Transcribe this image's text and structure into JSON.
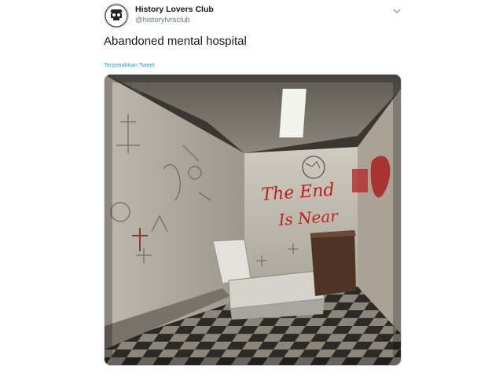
{
  "tweet": {
    "author": {
      "display_name": "History Lovers Club",
      "handle": "@historylvrsclub",
      "avatar_icon": "skull-logo-icon"
    },
    "menu_icon": "chevron-down-icon",
    "text": "Abandoned mental hospital",
    "translate_label": "Terjemahkan Tweet",
    "media": {
      "wall_text_line1": "The End",
      "wall_text_line2": "Is Near"
    }
  },
  "colors": {
    "name": "#14171a",
    "handle": "#657786",
    "link": "#1da1f2",
    "graffiti": "#c0201f"
  }
}
